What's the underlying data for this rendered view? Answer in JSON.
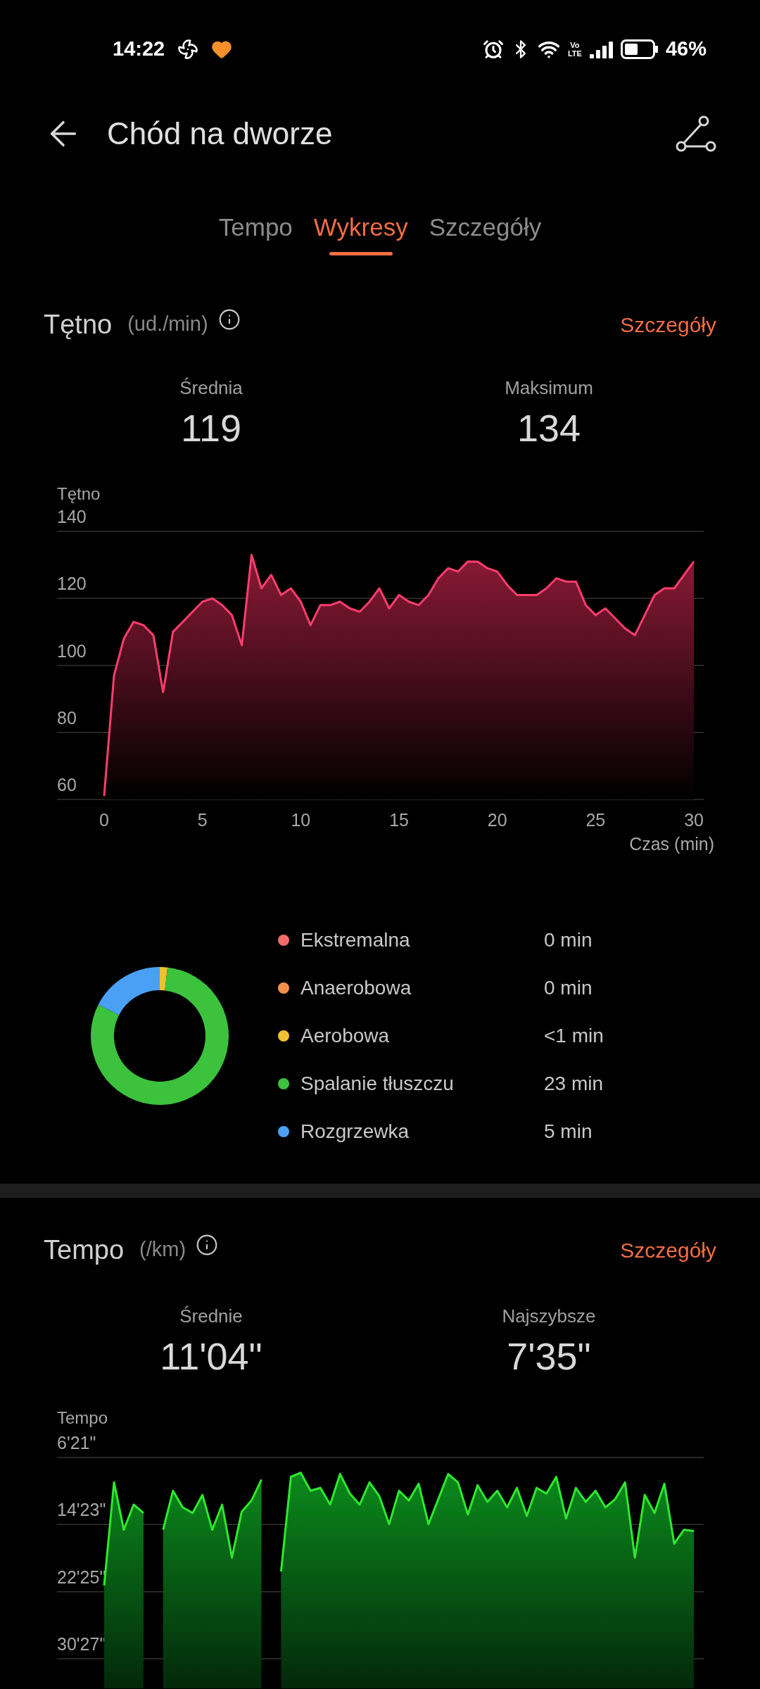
{
  "status_bar": {
    "time": "14:22",
    "network_type": "Vo LTE",
    "battery": "46%"
  },
  "header": {
    "title": "Chód na dworze"
  },
  "tabs": [
    {
      "label": "Tempo",
      "selected": false
    },
    {
      "label": "Wykresy",
      "selected": true
    },
    {
      "label": "Szczegóły",
      "selected": false
    }
  ],
  "heart_rate": {
    "title": "Tętno",
    "unit": "(ud./min)",
    "details_link": "Szczegóły",
    "stats": [
      {
        "label": "Średnia",
        "value": "119"
      },
      {
        "label": "Maksimum",
        "value": "134"
      }
    ],
    "chart_data": {
      "type": "area",
      "ylabel": "Tętno",
      "xlabel": "Czas (min)",
      "grid": true,
      "xlim": [
        -2.4,
        30.5
      ],
      "ylim": [
        60,
        140
      ],
      "xticks": [
        0,
        5,
        10,
        15,
        20,
        25,
        30
      ],
      "yticks": [
        60,
        80,
        100,
        120,
        140
      ],
      "x": [
        0,
        0.5,
        1,
        1.5,
        2,
        2.5,
        3,
        3.5,
        4,
        4.5,
        5,
        5.5,
        6,
        6.5,
        7,
        7.5,
        8,
        8.5,
        9,
        9.5,
        10,
        10.5,
        11,
        11.5,
        12,
        12.5,
        13,
        13.5,
        14,
        14.5,
        15,
        15.5,
        16,
        16.5,
        17,
        17.5,
        18,
        18.5,
        19,
        19.5,
        20,
        20.5,
        21,
        21.5,
        22,
        22.5,
        23,
        23.5,
        24,
        24.5,
        25,
        25.5,
        26,
        26.5,
        27,
        27.5,
        28,
        28.5,
        29,
        29.5,
        30
      ],
      "series": [
        {
          "color": "#ff3d6e",
          "values": [
            61,
            97,
            108,
            113,
            112,
            109,
            92,
            110,
            113,
            116,
            119,
            120,
            118,
            115,
            106,
            133,
            123,
            127,
            121,
            123,
            119,
            112,
            118,
            118,
            119,
            117,
            116,
            119,
            123,
            117,
            121,
            119,
            118,
            121,
            126,
            129,
            128,
            131,
            131,
            129,
            128,
            124,
            121,
            121,
            121,
            123,
            126,
            125,
            125,
            118,
            115,
            117,
            114,
            111,
            109,
            115,
            121,
            123,
            123,
            127,
            131
          ]
        }
      ]
    }
  },
  "zones": {
    "chart_data": {
      "type": "donut",
      "values": [
        0,
        0,
        1.8,
        80.7,
        17.5
      ]
    },
    "items": [
      {
        "name": "Ekstremalna",
        "value": "0 min",
        "color": "#f26b6b"
      },
      {
        "name": "Anaerobowa",
        "value": "0 min",
        "color": "#f5904a"
      },
      {
        "name": "Aerobowa",
        "value": "<1 min",
        "color": "#f0c030"
      },
      {
        "name": "Spalanie tłuszczu",
        "value": "23 min",
        "color": "#3cc23c"
      },
      {
        "name": "Rozgrzewka",
        "value": "5 min",
        "color": "#4aa0f5"
      }
    ]
  },
  "pace": {
    "title": "Tempo",
    "unit": "(/km)",
    "details_link": "Szczegóły",
    "stats": [
      {
        "label": "Średnie",
        "value": "11'04\""
      },
      {
        "label": "Najszybsze",
        "value": "7'35\""
      }
    ],
    "chart": {
      "axis_title": "Tempo",
      "y_labels": [
        "6'21\"",
        "14'23\"",
        "22'25\"",
        "30'27\""
      ]
    }
  }
}
